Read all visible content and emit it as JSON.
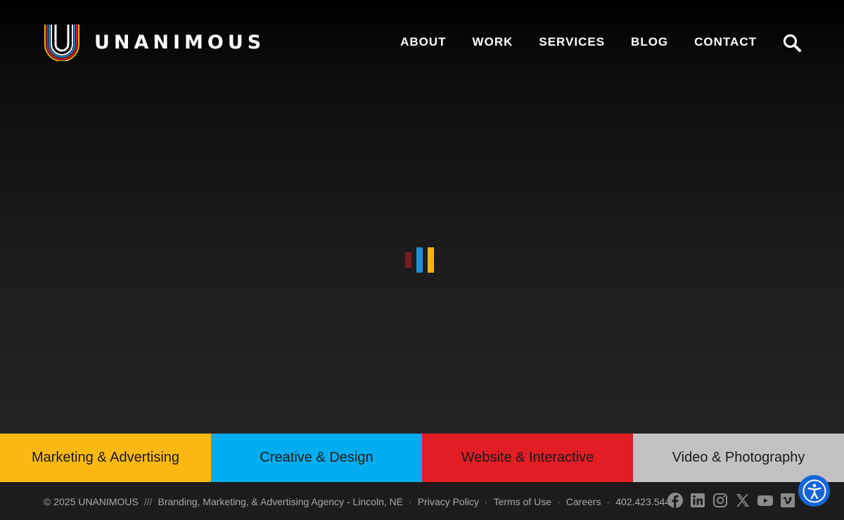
{
  "header": {
    "brand_name": "UNANIMOUS",
    "nav": [
      {
        "label": "ABOUT"
      },
      {
        "label": "WORK"
      },
      {
        "label": "SERVICES"
      },
      {
        "label": "BLOG"
      },
      {
        "label": "CONTACT"
      }
    ],
    "search_icon": "search-icon"
  },
  "loader": {
    "bars": [
      {
        "color": "#7a1a1f"
      },
      {
        "color": "#1f8fd0"
      },
      {
        "color": "#f2b11a"
      }
    ]
  },
  "services": [
    {
      "label": "Marketing & Advertising",
      "bg": "#fdb913",
      "color": "#1a1a1a"
    },
    {
      "label": "Creative & Design",
      "bg": "#00aeef",
      "color": "#1a1a1a"
    },
    {
      "label": "Website & Interactive",
      "bg": "#e21d24",
      "color": "#1a1a1a"
    },
    {
      "label": "Video & Photography",
      "bg": "#c2c2c2",
      "color": "#1a1a1a"
    }
  ],
  "footer": {
    "copyright": "© 2025 UNANIMOUS",
    "divider": "///",
    "tagline": "Branding, Marketing, & Advertising Agency - Lincoln, NE",
    "bullet": "·",
    "links": [
      {
        "label": "Privacy Policy"
      },
      {
        "label": "Terms of Use"
      },
      {
        "label": "Careers"
      },
      {
        "label": "402.423.5447"
      }
    ],
    "social": [
      "facebook-icon",
      "linkedin-icon",
      "instagram-icon",
      "x-icon",
      "youtube-icon",
      "vimeo-icon"
    ]
  },
  "colors": {
    "accessibility_button": "#1565d8",
    "social_icon": "#8a8a8a"
  }
}
